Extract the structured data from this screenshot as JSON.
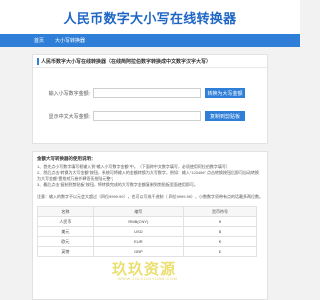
{
  "header": {
    "title": "人民币数字大小写在线转换器"
  },
  "nav": {
    "home": "首页",
    "current": "大小写转换器"
  },
  "panel": {
    "title": "人民币数字大小写在线转换器（在线简阿拉伯数字转换成中文数字汉字大写）",
    "row1": {
      "label": "输入小写数字金额:",
      "placeholder": "",
      "button": "转换为大写金额"
    },
    "row2": {
      "label": "显示中文大写金额:",
      "placeholder": "",
      "button": "复制到剪贴板"
    }
  },
  "intro": {
    "heading": "金额大写转换器的使用说明：",
    "lines": [
      "1、首先点小写数字填写框输入到“输入小写数字金额”中。（下面称中文数字填写，必须使用阿拉伯数字填写）",
      "2、然后点击“转换为大写金额”按钮，系统可将输入的金额转换为大写数字，例如：输入“123456” 点击转换按钮后即可自动转换",
      "为大写金额“壹拾贰万叁仟肆佰伍拾陆元整”；",
      "3、最后点击“复制到剪贴板”按钮，将转换完成的大写数字金额复制到剪贴板里面使用即可。"
    ],
    "note": "注意：输入的数字不以元会大超过（四位9999.99），也可以写成千进制（ 四位9999.99），小数数字须带有点的话最多两位数。"
  },
  "table": {
    "headers": [
      "名称",
      "缩写",
      "货币符号"
    ],
    "rows": [
      [
        "人民币",
        "RMB(CNY)",
        "¥"
      ],
      [
        "美元",
        "USD",
        "$"
      ],
      [
        "欧元",
        "EUR",
        "€"
      ],
      [
        "英镑",
        "GBP",
        "£"
      ]
    ]
  },
  "watermark": {
    "main": "玖玖资源",
    "sub": "WWW.JIUJIUZIYUAN.COM"
  }
}
